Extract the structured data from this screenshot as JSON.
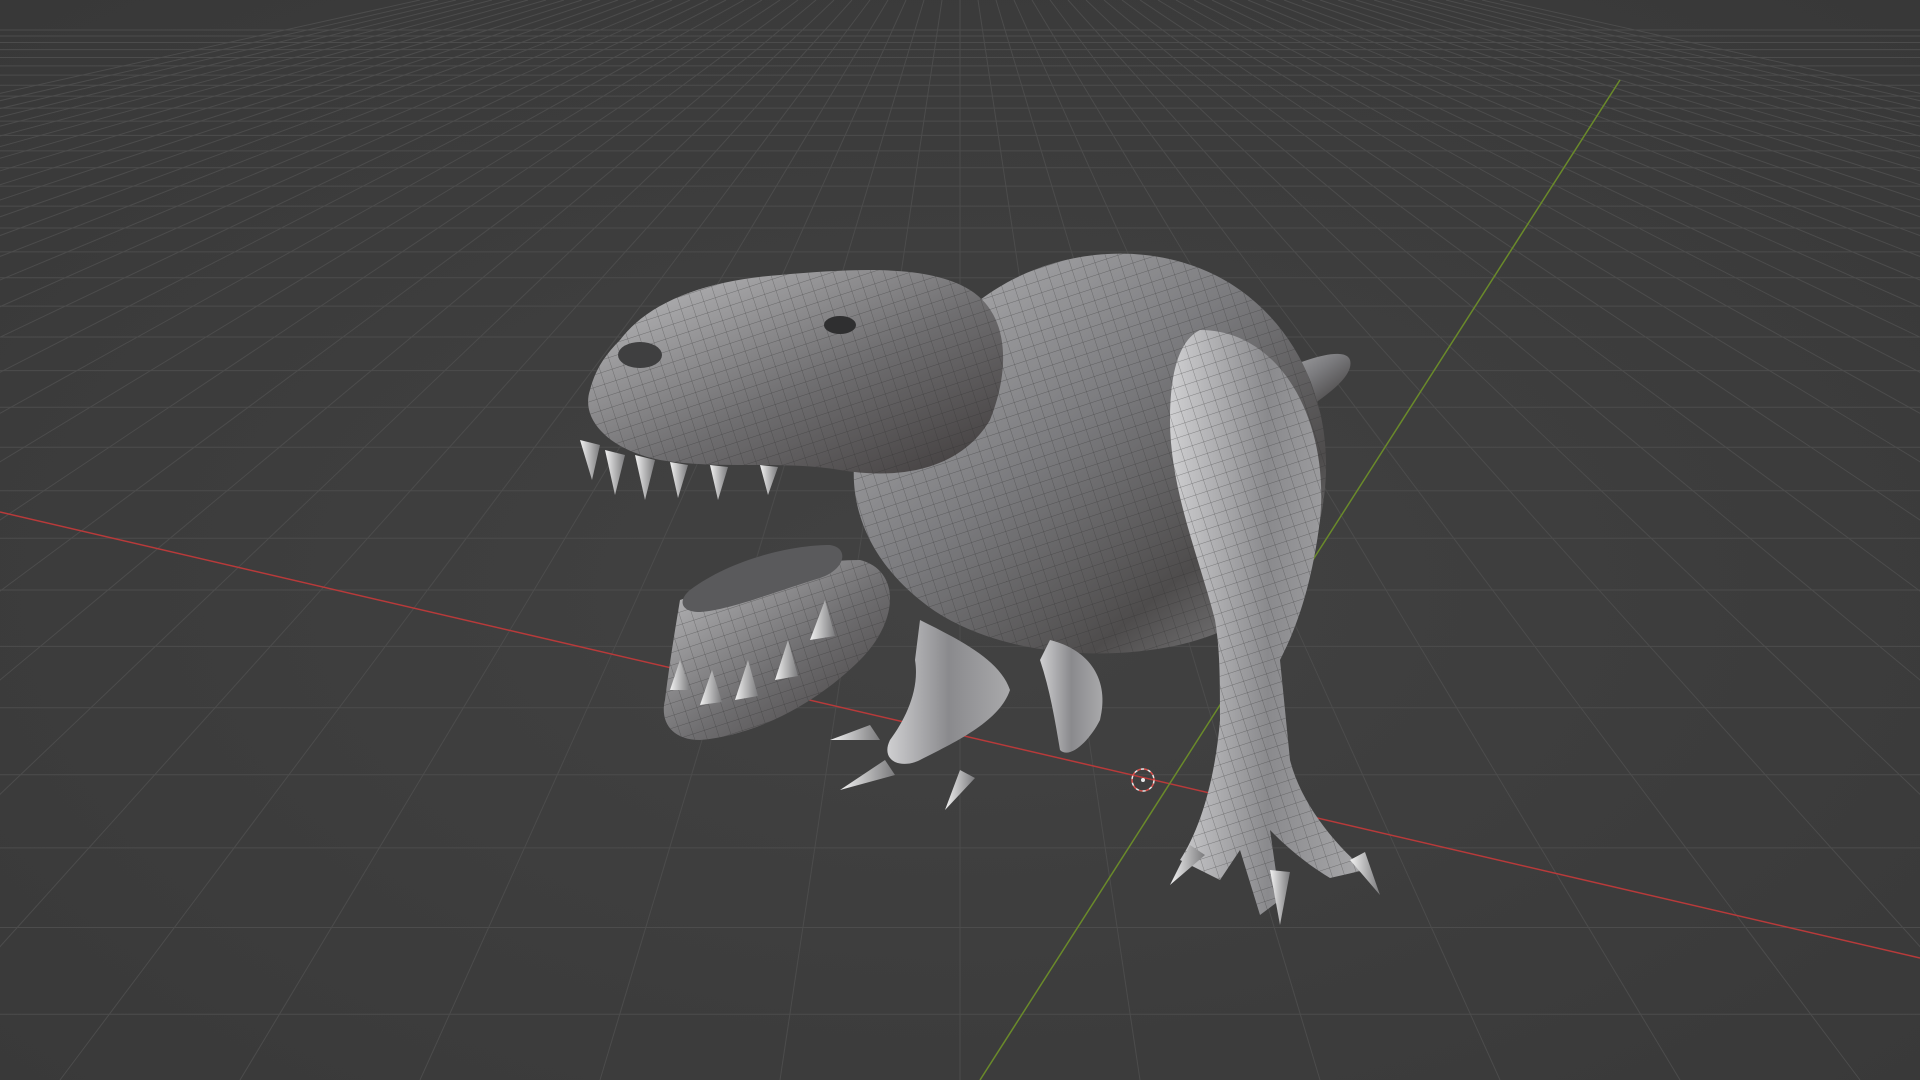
{
  "viewport": {
    "mode": "3d-viewport",
    "background_color": "#3d3d3d",
    "grid_color": "#4a4a4a",
    "x_axis_color": "#b83a3a",
    "y_axis_color": "#6a8a2a",
    "grid": true
  },
  "scene": {
    "object": "tyrannosaurus-sculpt-mesh",
    "shading": "matcap-metal-wireframe-overlay",
    "mesh_color": "#8a8a8c",
    "cursor_color": "#d9534f"
  }
}
